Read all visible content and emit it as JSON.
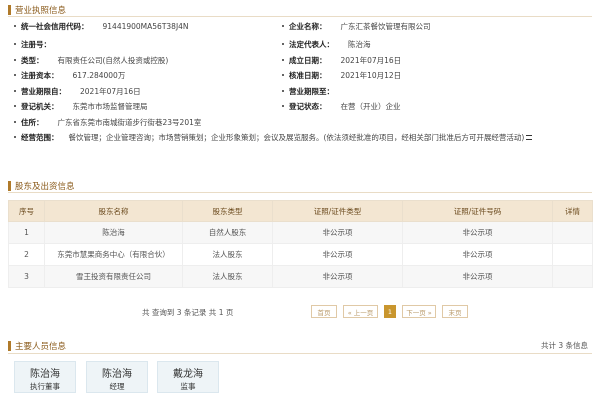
{
  "license": {
    "title": "营业执照信息",
    "credit_code_label": "统一社会信用代码：",
    "credit_code": "91441900MA56T38J4N",
    "company_name_label": "企业名称：",
    "company_name": "广东汇茶餐饮管理有限公司",
    "reg_no_label": "注册号：",
    "reg_no": "",
    "legal_rep_label": "法定代表人：",
    "legal_rep": "陈治海",
    "type_label": "类型：",
    "type": "有限责任公司(自然人投资或控股)",
    "established_label": "成立日期：",
    "established": "2021年07月16日",
    "capital_label": "注册资本：",
    "capital": "617.284000万",
    "approved_label": "核准日期：",
    "approved": "2021年10月12日",
    "term_label": "营业期限自：",
    "term": "2021年07月16日",
    "term_to_label": "营业期限至：",
    "term_to": "",
    "authority_label": "登记机关：",
    "authority": "东莞市市场监督管理局",
    "status_label": "登记状态：",
    "status": "在营（开业）企业",
    "address_label": "住所：",
    "address": "广东省东莞市南城街道步行街巷23号201室",
    "scope_label": "经营范围：",
    "scope": "餐饮管理；企业管理咨询；市场营销策划；企业形象策划；会议及展览服务。(依法须经批准的项目，经相关部门批准后方可开展经营活动)"
  },
  "shareholders": {
    "title": "股东及出资信息",
    "columns": [
      "序号",
      "股东名称",
      "股东类型",
      "证照/证件类型",
      "证照/证件号码",
      "详情"
    ],
    "rows": [
      [
        "1",
        "陈治海",
        "自然人股东",
        "非公示项",
        "非公示项",
        ""
      ],
      [
        "2",
        "东莞市慧果商务中心（有限合伙）",
        "法人股东",
        "非公示项",
        "非公示项",
        ""
      ],
      [
        "3",
        "雪王投资有限责任公司",
        "法人股东",
        "非公示项",
        "非公示项",
        ""
      ]
    ],
    "pager_info": "共 查询到 3 条记录 共 1 页",
    "first": "首页",
    "prev": "« 上一页",
    "current": "1",
    "next": "下一页 »",
    "last": "末页"
  },
  "personnel": {
    "title": "主要人员信息",
    "count": "共计 3 条信息",
    "people": [
      {
        "name": "陈治海",
        "role": "执行董事"
      },
      {
        "name": "陈治海",
        "role": "经理"
      },
      {
        "name": "戴龙海",
        "role": "监事"
      }
    ]
  }
}
